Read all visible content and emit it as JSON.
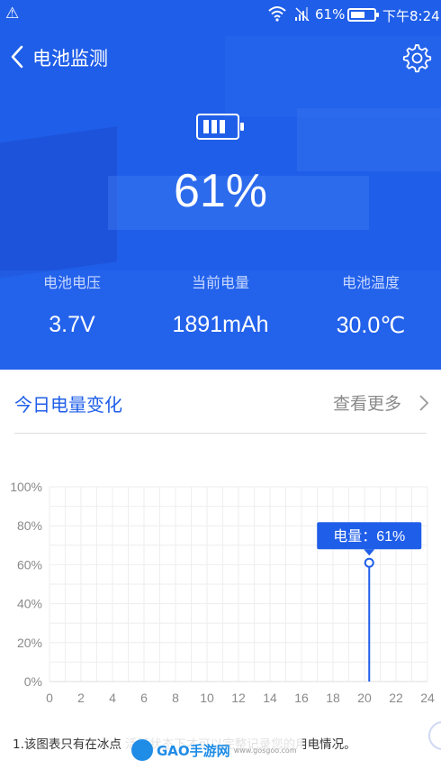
{
  "status_bar": {
    "warning_icon": "warning-icon",
    "battery_percent": "61%",
    "battery_level": 0.61,
    "time": "下午8:24"
  },
  "header": {
    "title": "电池监测",
    "back_icon": "chevron-left-icon",
    "settings_icon": "gear-icon"
  },
  "battery": {
    "icon": "battery-icon",
    "percent": "61%",
    "stats": [
      {
        "label": "电池电压",
        "value": "3.7V"
      },
      {
        "label": "当前电量",
        "value": "1891mAh"
      },
      {
        "label": "电池温度",
        "value": "30.0℃"
      }
    ]
  },
  "today": {
    "title": "今日电量变化",
    "more_label": "查看更多"
  },
  "chart_data": {
    "type": "line",
    "x_ticks": [
      "0",
      "2",
      "4",
      "6",
      "8",
      "10",
      "12",
      "14",
      "16",
      "18",
      "20",
      "22",
      "24"
    ],
    "y_ticks": [
      "0%",
      "20%",
      "40%",
      "60%",
      "80%",
      "100%"
    ],
    "xlim": [
      0,
      24
    ],
    "ylim": [
      0,
      100
    ],
    "grid": true,
    "series": [
      {
        "x": [
          20.3,
          20.3
        ],
        "y": [
          0,
          61
        ]
      }
    ],
    "tooltip": {
      "x": 20.3,
      "y": 61,
      "label": "电量：61%"
    },
    "color": "#1f5ee8"
  },
  "footnote": "1.该图表只有在冰点                    活跃状态下才可以完整记录您的用电情况。",
  "watermark": {
    "brand": "GAO手游网",
    "site": "www.gosgoo.com"
  },
  "colors": {
    "primary": "#1f5ee8",
    "label": "#c9d9ff"
  }
}
